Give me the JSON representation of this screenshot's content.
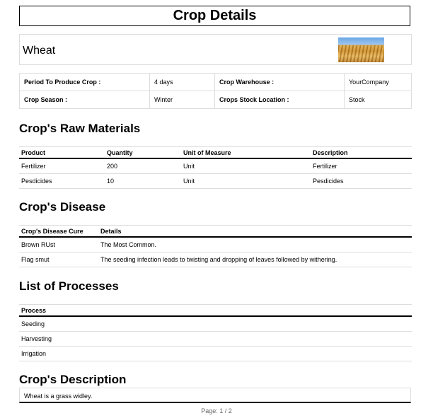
{
  "title": "Crop Details",
  "crop": {
    "name": "Wheat",
    "image_icon": "wheat-field-image"
  },
  "info": {
    "period_label": "Period To Produce Crop :",
    "period_value": "4 days",
    "warehouse_label": "Crop Warehouse :",
    "warehouse_value": "YourCompany",
    "season_label": "Crop Season :",
    "season_value": "Winter",
    "stock_label": "Crops Stock Location :",
    "stock_value": "Stock"
  },
  "raw_materials": {
    "heading": "Crop's Raw Materials",
    "columns": [
      "Product",
      "Quantity",
      "Unit of Measure",
      "Description"
    ],
    "rows": [
      [
        "Fertilizer",
        "200",
        "Unit",
        "Fertilizer"
      ],
      [
        "Pesdicides",
        "10",
        "Unit",
        "Pesdicides"
      ]
    ]
  },
  "disease": {
    "heading": "Crop's Disease",
    "columns": [
      "Crop's Disease Cure",
      "Details"
    ],
    "rows": [
      [
        "Brown RUst",
        "The Most Common."
      ],
      [
        "Flag smut",
        "The seeding infection leads to twisting and dropping of leaves followed by withering."
      ]
    ]
  },
  "processes": {
    "heading": "List of Processes",
    "column": "Process",
    "rows": [
      "Seeding",
      "Harvesting",
      "Irrigation"
    ]
  },
  "description": {
    "heading": "Crop's Description",
    "text": "Wheat is a grass widley."
  },
  "page": "Page: 1 / 2"
}
